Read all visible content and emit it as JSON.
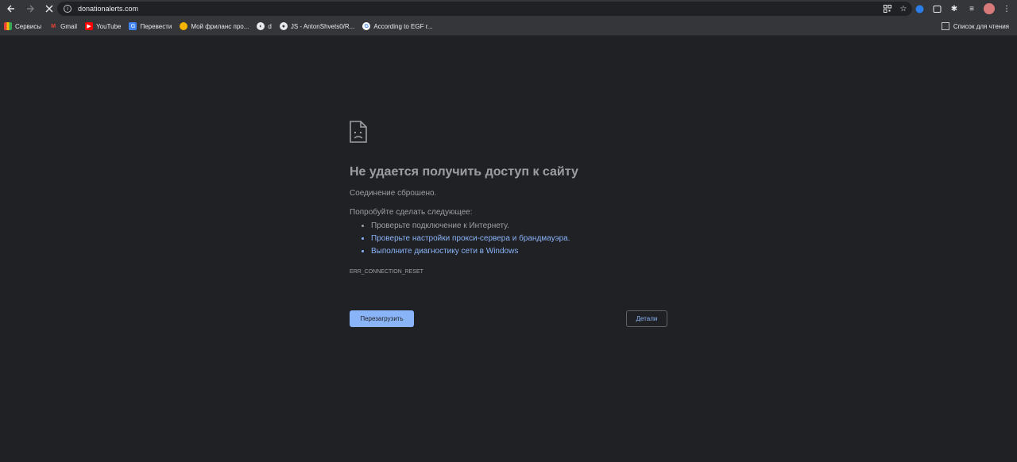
{
  "browser": {
    "url": "donationalerts.com",
    "icons": [
      "back-icon",
      "forward-icon",
      "stop-icon",
      "info-icon",
      "qr-icon",
      "star-icon",
      "extension-icon",
      "menu-icon"
    ]
  },
  "bookmarks": [
    {
      "label": "Сервисы",
      "icon": "apps-icon",
      "color": "#ea4335"
    },
    {
      "label": "Gmail",
      "icon": "gmail-icon",
      "color": "#ea4335"
    },
    {
      "label": "YouTube",
      "icon": "youtube-icon",
      "color": "#ff0000"
    },
    {
      "label": "Перевести",
      "icon": "translate-icon",
      "color": "#4285f4"
    },
    {
      "label": "Мой фриланс про...",
      "icon": "freelance-icon",
      "color": "#f4b400"
    },
    {
      "label": "d",
      "icon": "globe-icon",
      "color": "#9aa0a6"
    },
    {
      "label": "JS - AntonShvets0/R...",
      "icon": "github-icon",
      "color": "#e8eaed"
    },
    {
      "label": "According to EGF r...",
      "icon": "google-icon",
      "color": "#4285f4"
    }
  ],
  "reading_list": "Список для чтения",
  "error": {
    "title": "Не удается получить доступ к сайту",
    "subtitle": "Соединение сброшено.",
    "try_label": "Попробуйте сделать следующее:",
    "suggestions": [
      "Проверьте подключение к Интернету.",
      "Проверьте настройки прокси-сервера и брандмауэра.",
      "Выполните диагностику сети в Windows"
    ],
    "code": "ERR_CONNECTION_RESET"
  },
  "buttons": {
    "reload": "Перезагрузить",
    "details": "Детали"
  }
}
